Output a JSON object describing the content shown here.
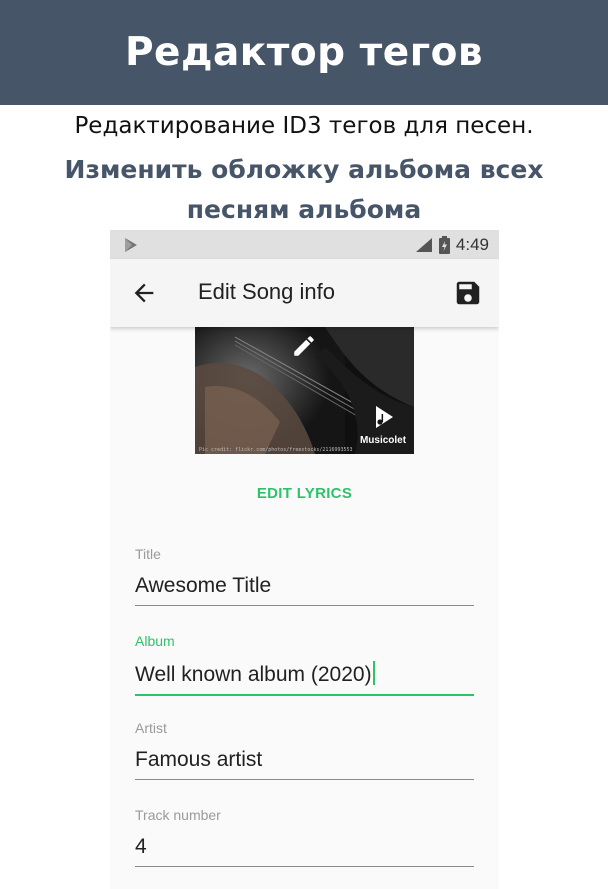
{
  "banner": {
    "title": "Редактор тегов"
  },
  "promo": {
    "subtitle": "Редактирование ID3 тегов для песен.",
    "feature": "Изменить обложку альбома всех песням альбома"
  },
  "statusbar": {
    "time": "4:49"
  },
  "appbar": {
    "title": "Edit Song info"
  },
  "cover": {
    "brand": "Musicolet",
    "credit": "Pic credit: flickr.com/photos/freestocks/2116993553"
  },
  "actions": {
    "edit_lyrics": "EDIT LYRICS"
  },
  "form": {
    "fields": [
      {
        "label": "Title",
        "value": "Awesome Title"
      },
      {
        "label": "Album",
        "value": "Well known album (2020)"
      },
      {
        "label": "Artist",
        "value": "Famous artist"
      },
      {
        "label": "Track number",
        "value": "4"
      }
    ]
  },
  "colors": {
    "banner": "#475569",
    "accent": "#2ec26a",
    "appbar": "#f5f5f5"
  }
}
